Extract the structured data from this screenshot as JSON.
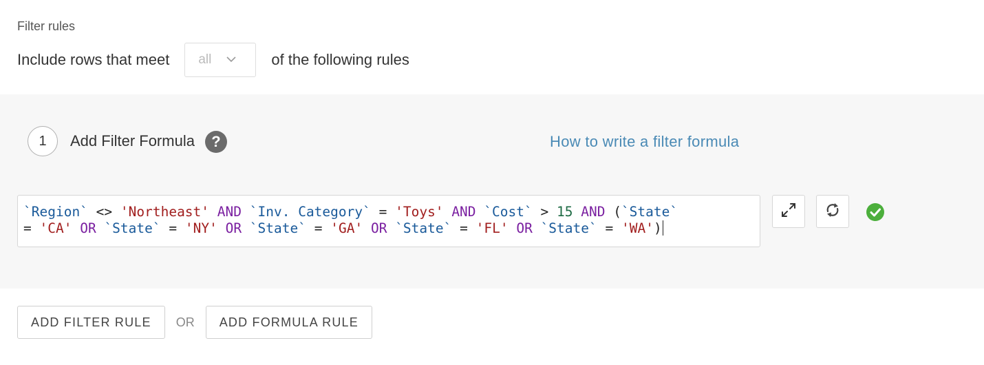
{
  "header": {
    "section_title": "Filter rules",
    "include_prefix": "Include rows that meet",
    "match_select": {
      "value": "all"
    },
    "include_suffix": "of the following rules"
  },
  "rule": {
    "step_number": "1",
    "title": "Add Filter Formula",
    "help_glyph": "?",
    "help_link": "How to write a filter formula",
    "formula_lines": [
      [
        {
          "t": "field",
          "v": "`Region`"
        },
        {
          "t": "op",
          "v": " <> "
        },
        {
          "t": "str",
          "v": "'Northeast'"
        },
        {
          "t": "op",
          "v": " "
        },
        {
          "t": "kw",
          "v": "AND"
        },
        {
          "t": "op",
          "v": " "
        },
        {
          "t": "field",
          "v": "`Inv. Category`"
        },
        {
          "t": "op",
          "v": " = "
        },
        {
          "t": "str",
          "v": "'Toys'"
        },
        {
          "t": "op",
          "v": " "
        },
        {
          "t": "kw",
          "v": "AND"
        },
        {
          "t": "op",
          "v": " "
        },
        {
          "t": "field",
          "v": "`Cost`"
        },
        {
          "t": "op",
          "v": " > "
        },
        {
          "t": "num",
          "v": "15"
        },
        {
          "t": "op",
          "v": " "
        },
        {
          "t": "kw",
          "v": "AND"
        },
        {
          "t": "op",
          "v": " ("
        },
        {
          "t": "field",
          "v": "`State`"
        }
      ],
      [
        {
          "t": "op",
          "v": "= "
        },
        {
          "t": "str",
          "v": "'CA'"
        },
        {
          "t": "op",
          "v": " "
        },
        {
          "t": "kw",
          "v": "OR"
        },
        {
          "t": "op",
          "v": " "
        },
        {
          "t": "field",
          "v": "`State`"
        },
        {
          "t": "op",
          "v": " = "
        },
        {
          "t": "str",
          "v": "'NY'"
        },
        {
          "t": "op",
          "v": " "
        },
        {
          "t": "kw",
          "v": "OR"
        },
        {
          "t": "op",
          "v": " "
        },
        {
          "t": "field",
          "v": "`State`"
        },
        {
          "t": "op",
          "v": " = "
        },
        {
          "t": "str",
          "v": "'GA'"
        },
        {
          "t": "op",
          "v": " "
        },
        {
          "t": "kw",
          "v": "OR"
        },
        {
          "t": "op",
          "v": " "
        },
        {
          "t": "field",
          "v": "`State`"
        },
        {
          "t": "op",
          "v": " = "
        },
        {
          "t": "str",
          "v": "'FL'"
        },
        {
          "t": "op",
          "v": " "
        },
        {
          "t": "kw",
          "v": "OR"
        },
        {
          "t": "op",
          "v": " "
        },
        {
          "t": "field",
          "v": "`State`"
        },
        {
          "t": "op",
          "v": " = "
        },
        {
          "t": "str",
          "v": "'WA'"
        },
        {
          "t": "op",
          "v": ")"
        }
      ]
    ],
    "icons": {
      "expand": "expand-icon",
      "refresh": "refresh-icon",
      "valid": "check-circle-icon"
    }
  },
  "footer": {
    "add_filter_rule": "ADD FILTER RULE",
    "or_label": "OR",
    "add_formula_rule": "ADD FORMULA RULE"
  },
  "colors": {
    "panel_bg": "#f7f7f7",
    "link": "#4a8ab5",
    "field": "#1a5a9a",
    "string": "#a11e1e",
    "keyword": "#7a1fa0",
    "number": "#1d6a43",
    "valid": "#4caf3c"
  }
}
